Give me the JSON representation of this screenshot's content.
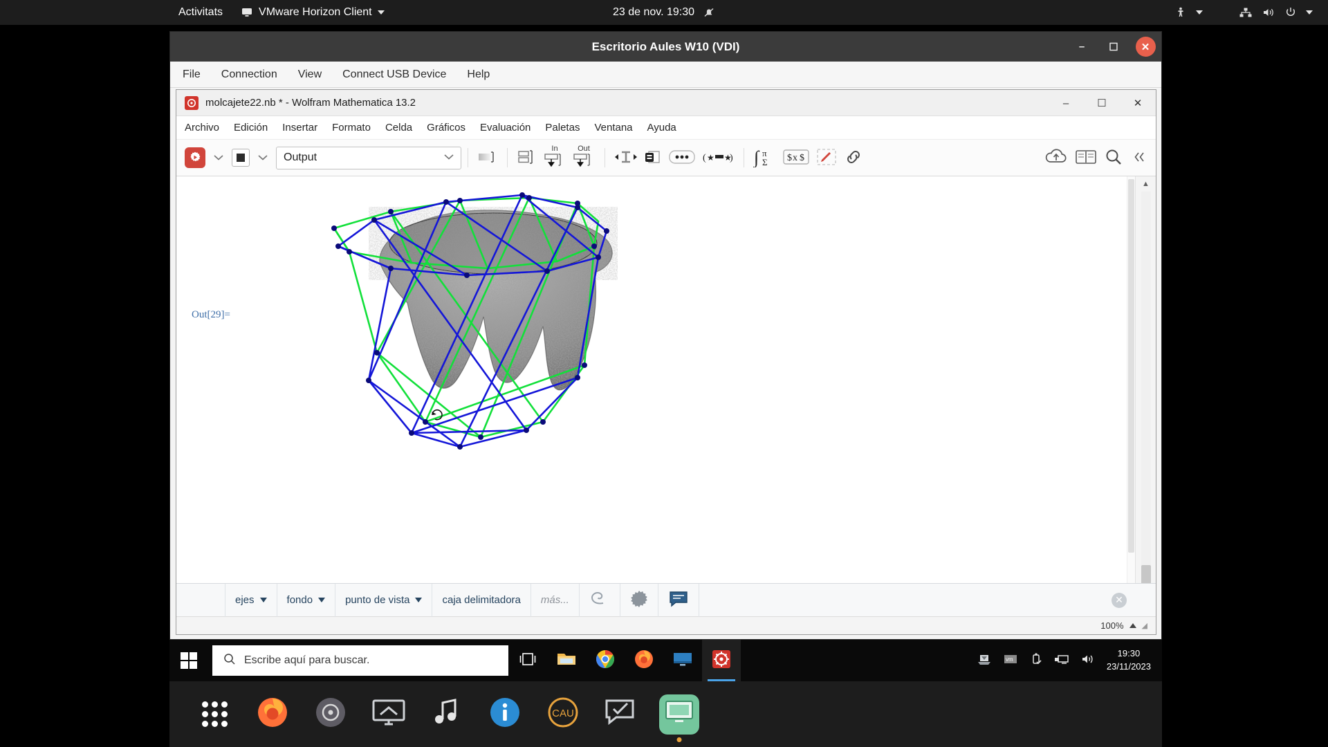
{
  "gnome": {
    "activities": "Activitats",
    "app_menu": "VMware Horizon Client",
    "clock": "23 de nov.  19:30",
    "icons": {
      "app": "monitor-icon",
      "notifications_off": "bell-slash-icon",
      "accessibility": "accessibility-icon",
      "network": "network-wired-icon",
      "volume": "volume-icon",
      "power": "power-icon",
      "menu_caret": "chevron-down-icon"
    }
  },
  "horizon": {
    "title": "Escritorio Aules W10 (VDI)",
    "menu": [
      "File",
      "Connection",
      "View",
      "Connect USB Device",
      "Help"
    ],
    "window_buttons": {
      "minimize": "–",
      "maximize": "☐",
      "close": "✕"
    }
  },
  "mathematica": {
    "title": "molcajete22.nb * - Wolfram Mathematica 13.2",
    "window_buttons": {
      "minimize": "–",
      "maximize": "☐",
      "close": "✕"
    },
    "menu": [
      "Archivo",
      "Edición",
      "Insertar",
      "Formato",
      "Celda",
      "Gráficos",
      "Evaluación",
      "Paletas",
      "Ventana",
      "Ayuda"
    ],
    "toolbar": {
      "evaluate_icon": "evaluate-gear-play-icon",
      "evaluate_caret": "chevron-down-icon",
      "abort_icon": "stop-square-icon",
      "abort_caret": "chevron-down-icon",
      "style_value": "Output",
      "style_caret": "chevron-down-icon",
      "cell_bracket_icon": "cell-bracket-icon",
      "group_cells_icon": "group-cells-icon",
      "in_label": "In",
      "out_label": "Out",
      "text_cursor_icon": "text-width-icon",
      "duplicate_cell_icon": "duplicate-cell-icon",
      "more_icon": "ellipsis-icon",
      "decorated_icon": "star-bracket-icon",
      "integral_icon": "integral-pi-sigma-icon",
      "tex_icon": "dollar-x-dollar-icon",
      "draw_icon": "pencil-icon",
      "link_icon": "link-icon",
      "cloud_icon": "cloud-upload-icon",
      "docs_icon": "documentation-icon",
      "search_icon": "search-icon",
      "collapse_icon": "double-chevron-left-icon"
    },
    "notebook": {
      "out_label": "Out[29]=",
      "graphic_alt": "3D molcajete mesh with blue and green convex hull wireframe"
    },
    "graphics_bar": {
      "items": [
        {
          "label": "ejes",
          "has_caret": true
        },
        {
          "label": "fondo",
          "has_caret": true
        },
        {
          "label": "punto de vista",
          "has_caret": true
        },
        {
          "label": "caja delimitadora",
          "has_caret": false
        },
        {
          "label": "más...",
          "has_caret": false
        }
      ],
      "spiral_icon": "spiral-rotate-icon",
      "gear_icon": "sunburst-gear-icon",
      "comment_icon": "speech-bubble-icon",
      "clear_icon": "clear-circle-x-icon"
    },
    "status": {
      "zoom": "100%",
      "zoom_caret": "triangle-up-icon"
    }
  },
  "windows_taskbar": {
    "start_icon": "windows-logo-icon",
    "search_placeholder": "Escribe aquí para buscar.",
    "search_icon": "search-icon",
    "task_view_icon": "task-view-icon",
    "pinned": [
      {
        "name": "file-explorer-icon"
      },
      {
        "name": "google-chrome-icon"
      },
      {
        "name": "firefox-icon"
      },
      {
        "name": "remote-desktop-icon"
      },
      {
        "name": "wolfram-mathematica-icon",
        "active": true
      }
    ],
    "tray": [
      {
        "name": "snipping-tool-icon"
      },
      {
        "name": "vmware-tools-icon"
      },
      {
        "name": "usb-safe-remove-icon"
      },
      {
        "name": "network-icon"
      },
      {
        "name": "volume-icon"
      }
    ],
    "clock_time": "19:30",
    "clock_date": "23/11/2023"
  },
  "ubuntu_dock": {
    "items": [
      {
        "name": "show-applications-icon"
      },
      {
        "name": "firefox-icon"
      },
      {
        "name": "settings-icon"
      },
      {
        "name": "screen-share-icon"
      },
      {
        "name": "music-icon"
      },
      {
        "name": "info-icon"
      },
      {
        "name": "cau-icon"
      },
      {
        "name": "chat-icon"
      },
      {
        "name": "vmware-horizon-icon",
        "running": true
      }
    ]
  }
}
